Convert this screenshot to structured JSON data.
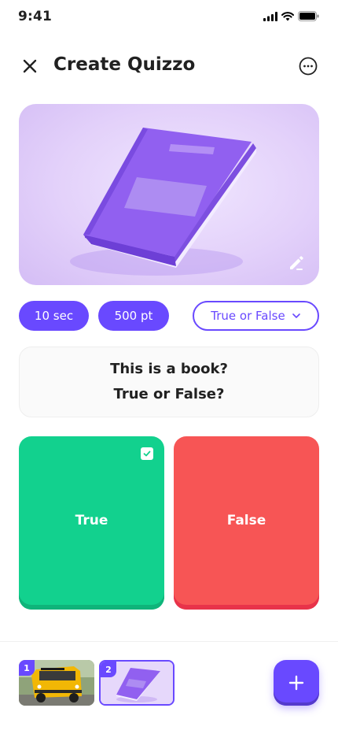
{
  "status_bar": {
    "time": "9:41"
  },
  "header": {
    "title": "Create Quizzo"
  },
  "chips": {
    "time_limit": "10 sec",
    "points": "500 pt",
    "question_type": "True or False"
  },
  "question": {
    "line1": "This is a book?",
    "line2": "True or False?"
  },
  "answers": [
    {
      "label": "True",
      "correct": true,
      "color": "#12d18e"
    },
    {
      "label": "False",
      "correct": false,
      "color": "#f75555"
    }
  ],
  "slides": [
    {
      "number": "1",
      "image": "school-bus"
    },
    {
      "number": "2",
      "image": "purple-book",
      "selected": true
    }
  ],
  "colors": {
    "primary": "#6949ff",
    "true": "#12d18e",
    "false": "#f75555"
  }
}
